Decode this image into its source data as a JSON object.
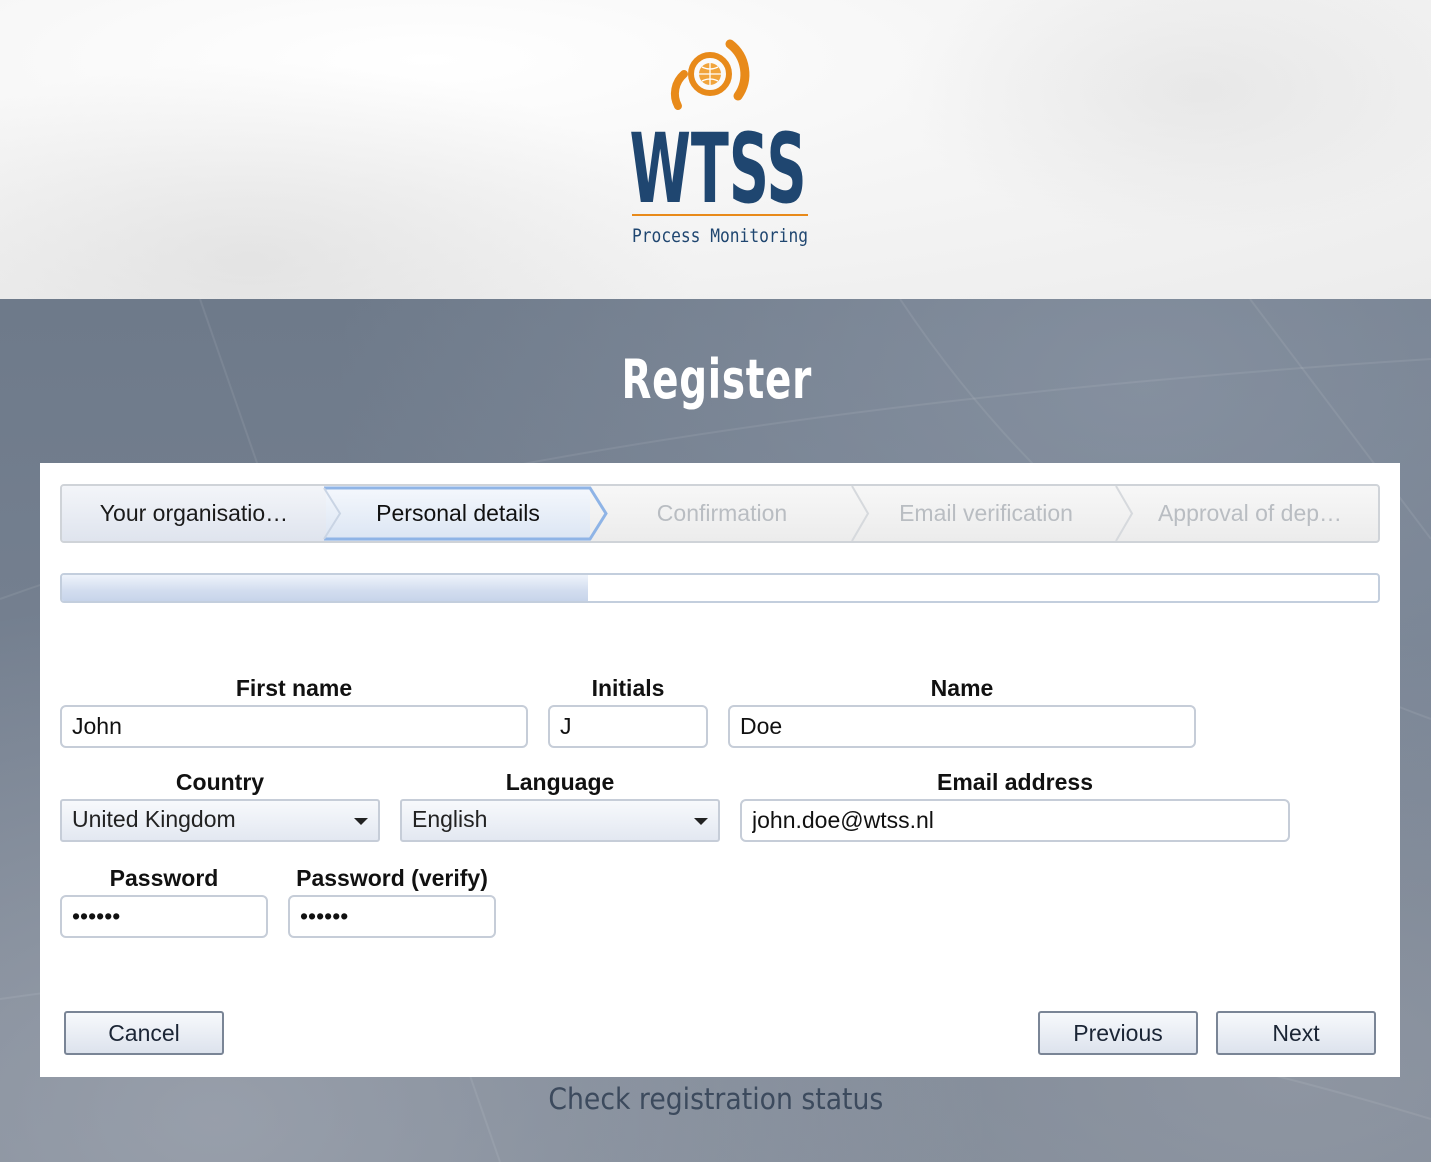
{
  "brand": {
    "name": "WTSS",
    "tagline": "Process Monitoring",
    "colors": {
      "navy": "#1f4670",
      "orange": "#e88a1a"
    }
  },
  "page": {
    "title": "Register"
  },
  "wizard": {
    "steps": [
      {
        "label": "Your organisatio…",
        "state": "done"
      },
      {
        "label": "Personal details",
        "state": "active"
      },
      {
        "label": "Confirmation",
        "state": "pending"
      },
      {
        "label": "Email verification",
        "state": "pending"
      },
      {
        "label": "Approval of dep…",
        "state": "pending"
      }
    ],
    "progress_fraction": 0.4
  },
  "form": {
    "first_name": {
      "label": "First name",
      "value": "John"
    },
    "initials": {
      "label": "Initials",
      "value": "J"
    },
    "name": {
      "label": "Name",
      "value": "Doe"
    },
    "country": {
      "label": "Country",
      "value": "United Kingdom"
    },
    "language": {
      "label": "Language",
      "value": "English"
    },
    "email": {
      "label": "Email address",
      "value": "john.doe@wtss.nl"
    },
    "password": {
      "label": "Password",
      "masked": "••••••"
    },
    "password_verify": {
      "label": "Password (verify)",
      "masked": "••••••"
    }
  },
  "buttons": {
    "cancel": "Cancel",
    "previous": "Previous",
    "next": "Next"
  },
  "footer": {
    "check_status": "Check registration status"
  }
}
